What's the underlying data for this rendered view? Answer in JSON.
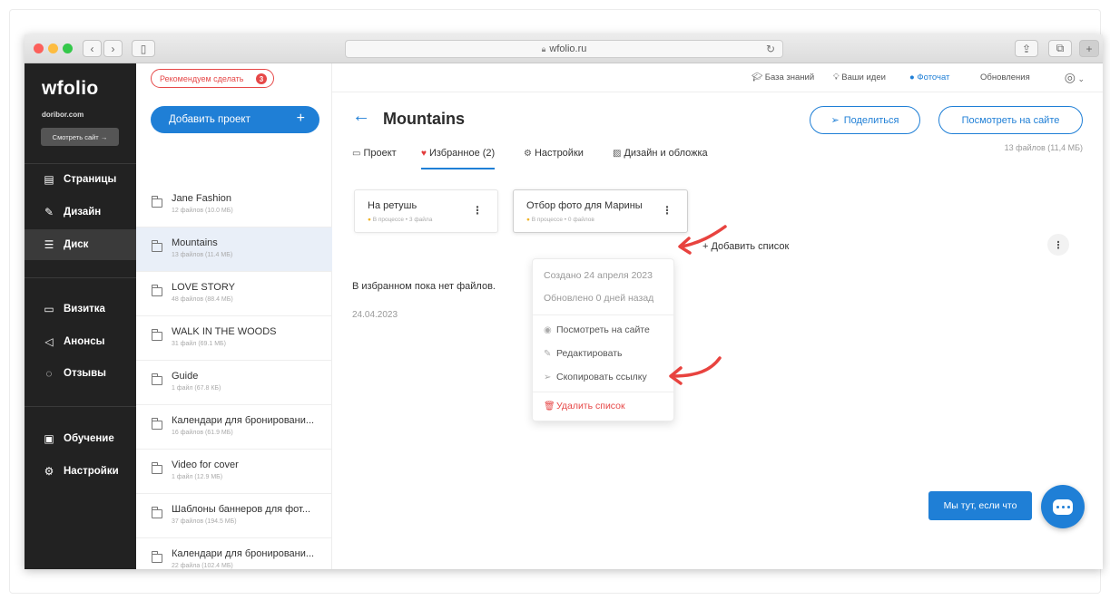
{
  "browser": {
    "url": "wfolio.ru",
    "traffic_colors": [
      "#fc605b",
      "#fdbc40",
      "#34c84a"
    ]
  },
  "sidebar": {
    "logo": "wfolio",
    "site_name": "doribor.com",
    "site_button": "Смотреть сайт →",
    "items": [
      {
        "icon": "page-icon",
        "glyph": "▤",
        "label": "Страницы"
      },
      {
        "icon": "brush-icon",
        "glyph": "✎",
        "label": "Дизайн"
      },
      {
        "icon": "disk-icon",
        "glyph": "☰",
        "label": "Диск"
      },
      {
        "icon": "card-icon",
        "glyph": "▭",
        "label": "Визитка"
      },
      {
        "icon": "megaphone-icon",
        "glyph": "◁",
        "label": "Анонсы"
      },
      {
        "icon": "reviews-icon",
        "glyph": "◌",
        "label": "Отзывы"
      },
      {
        "icon": "book-icon",
        "glyph": "▣",
        "label": "Обучение"
      },
      {
        "icon": "gear-icon",
        "glyph": "⚙",
        "label": "Настройки"
      }
    ]
  },
  "project_list": {
    "recommend_label": "Рекомендуем сделать",
    "recommend_count": "3",
    "add_project_label": "Добавить проект",
    "projects": [
      {
        "name": "Jane Fashion",
        "info": "12 файлов (10.0 МБ)"
      },
      {
        "name": "Mountains",
        "info": "13 файлов (11.4 МБ)"
      },
      {
        "name": "LOVE STORY",
        "info": "48 файлов (88.4 МБ)"
      },
      {
        "name": "WALK IN THE WOODS",
        "info": "31 файл (69.1 МБ)"
      },
      {
        "name": "Guide",
        "info": "1 файл (67.8 КБ)"
      },
      {
        "name": "Календари для бронировани...",
        "info": "16 файлов (61.9 МБ)"
      },
      {
        "name": "Video for cover",
        "info": "1 файл (12.9 МБ)"
      },
      {
        "name": "Шаблоны баннеров для фот...",
        "info": "37 файлов (194.5 МБ)"
      },
      {
        "name": "Календари для бронировани...",
        "info": "22 файла (102.4 МБ)"
      }
    ]
  },
  "topnav": {
    "knowledge": "База знаний",
    "ideas": "Ваши идеи",
    "photochat": "Фоточат",
    "updates": "Обновления"
  },
  "main": {
    "title": "Mountains",
    "share_label": "Поделиться",
    "view_label": "Посмотреть на сайте",
    "files_count": "13 файлов (11,4 МБ)",
    "tabs": [
      {
        "label": "Проект"
      },
      {
        "label": "Избранное (2)"
      },
      {
        "label": "Настройки"
      },
      {
        "label": "Дизайн и обложка"
      }
    ],
    "lists": [
      {
        "title": "На ретушь",
        "meta": "В процессе • 3 файла"
      },
      {
        "title": "Отбор фото для Марины",
        "meta": "В процессе • 0 файлов"
      }
    ],
    "add_list_label": "Добавить список",
    "empty_text": "В избранном пока нет файлов.",
    "date": "24.04.2023"
  },
  "dropdown": {
    "created": "Создано 24 апреля 2023",
    "updated": "Обновлено 0 дней назад",
    "view": "Посмотреть на сайте",
    "edit": "Редактировать",
    "copy_link": "Скопировать ссылку",
    "delete": "Удалить список"
  },
  "chat": {
    "label": "Мы тут, если что"
  },
  "colors": {
    "accent": "#1f7fd6",
    "danger": "#e64848",
    "sidebar_bg": "#222222",
    "annotation_arrow": "#e8433f"
  }
}
